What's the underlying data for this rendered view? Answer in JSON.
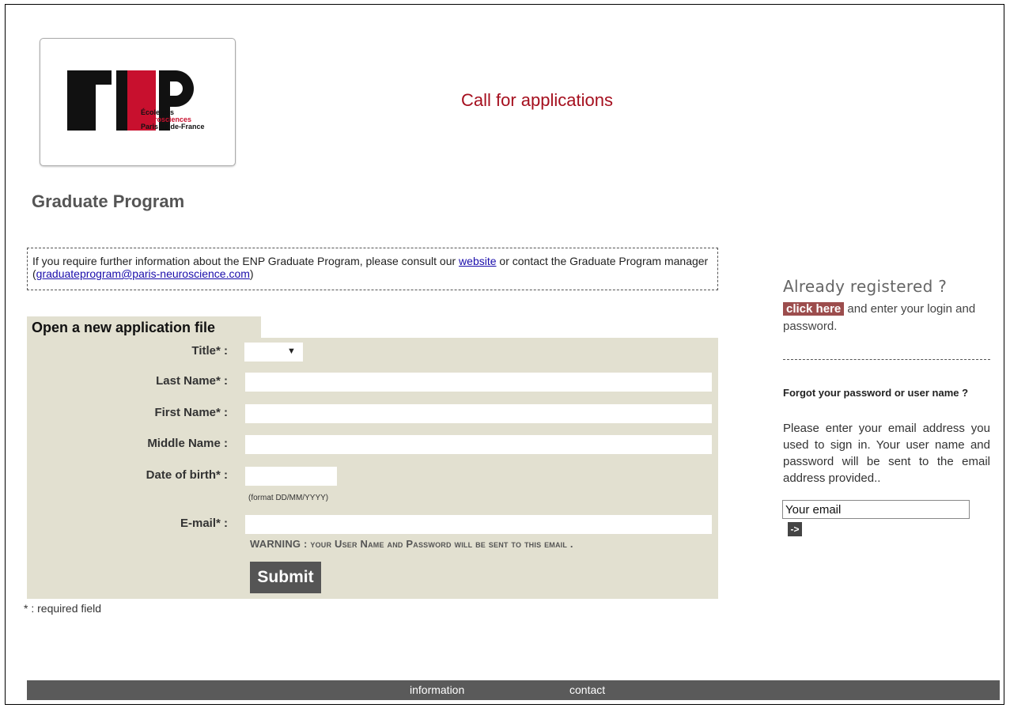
{
  "header": {
    "logo": {
      "line1": "École des",
      "line2": "Neurosciences",
      "line3": "Paris Île-de-France"
    },
    "call_title": "Call for applications",
    "page_title": "Graduate Program"
  },
  "info": {
    "text_before": "If you require further information about the ENP Graduate Program, please consult our ",
    "website_link": "website",
    "text_middle": " or contact the Graduate Program manager (",
    "email_link": "graduateprogram@paris-neuroscience.com",
    "text_after": ")"
  },
  "form": {
    "tab_title": "Open a new application file",
    "title_label": "Title* :",
    "title_arrow": "▼",
    "last_name_label": "Last Name* :",
    "first_name_label": "First Name* :",
    "middle_name_label": "Middle Name :",
    "dob_label": "Date of birth* :",
    "dob_hint": "(format DD/MM/YYYY)",
    "email_label": "E-mail* :",
    "warning": "WARNING : your User Name and Password will be sent to this email .",
    "submit_label": "Submit",
    "required_note": "* : required field"
  },
  "sidebar": {
    "already_title": "Already registered ?",
    "click_here": "click here",
    "login_text": " and enter your login and password.",
    "forgot_title": "Forgot your password or user name ?",
    "forgot_text": "Please enter your email address you used to sign in. Your user name and password will be sent to the email address provided..",
    "email_value": "Your email",
    "go_label": "->"
  },
  "footer": {
    "links": [
      "information",
      "contact"
    ]
  }
}
